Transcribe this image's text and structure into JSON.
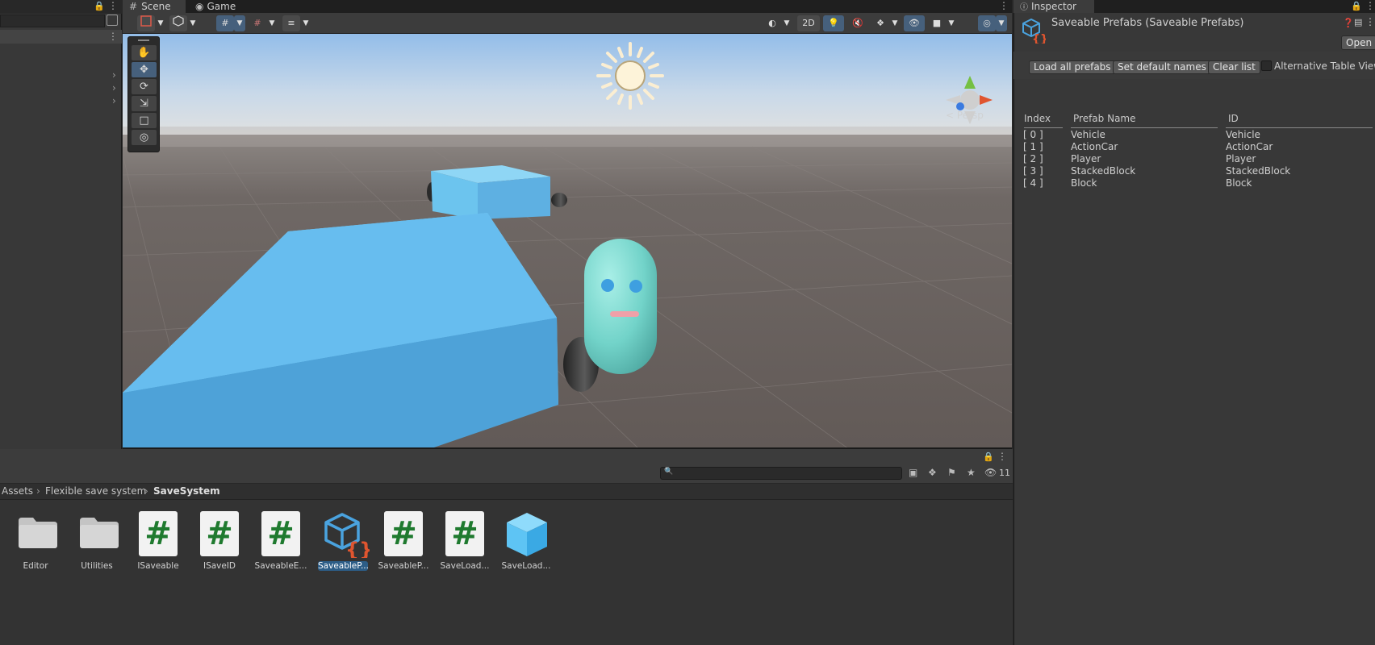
{
  "scene_panel": {
    "tabs": [
      {
        "label": "Scene"
      },
      {
        "label": "Game"
      }
    ],
    "mode_2d": "2D",
    "camera_label": "< Persp",
    "tools": [
      "hand-icon",
      "move-icon",
      "rotate-icon",
      "scale-icon",
      "rect-icon",
      "transform-icon"
    ]
  },
  "project": {
    "breadcrumbs": [
      "Assets",
      "Flexible save system",
      "SaveSystem"
    ],
    "hidden_count": "11",
    "assets": [
      {
        "label": "Editor",
        "type": "folder"
      },
      {
        "label": "Utilities",
        "type": "folder"
      },
      {
        "label": "ISaveable",
        "type": "script"
      },
      {
        "label": "ISaveID",
        "type": "script"
      },
      {
        "label": "SaveableE...",
        "type": "script"
      },
      {
        "label": "SaveableP...",
        "type": "scriptable",
        "selected": true
      },
      {
        "label": "SaveableP...",
        "type": "script"
      },
      {
        "label": "SaveLoad...",
        "type": "script"
      },
      {
        "label": "SaveLoad...",
        "type": "prefab"
      }
    ]
  },
  "inspector": {
    "tab_label": "Inspector",
    "object_title": "Saveable Prefabs (Saveable Prefabs)",
    "open_label": "Open",
    "buttons": {
      "load_all": "Load all prefabs",
      "set_default": "Set default names",
      "clear_list": "Clear list"
    },
    "alt_toggle_label": "Alternative Table View",
    "table": {
      "headers": [
        "Index",
        "Prefab Name",
        "ID"
      ],
      "rows": [
        {
          "index": "[ 0 ]",
          "name": "Vehicle",
          "id": "Vehicle"
        },
        {
          "index": "[ 1 ]",
          "name": "ActionCar",
          "id": "ActionCar"
        },
        {
          "index": "[ 2 ]",
          "name": "Player",
          "id": "Player"
        },
        {
          "index": "[ 3 ]",
          "name": "StackedBlock",
          "id": "StackedBlock"
        },
        {
          "index": "[ 4 ]",
          "name": "Block",
          "id": "Block"
        }
      ]
    }
  },
  "colors": {
    "accent_blue": "#46607c",
    "selection": "#2c5d87",
    "sky_top": "#9ec3ea",
    "ground": "#6e6764",
    "block": "#5fb5ea",
    "capsule": "#7dd6cf",
    "script_hash": "#1f7a2f",
    "scriptable_brace": "#e0552f"
  }
}
